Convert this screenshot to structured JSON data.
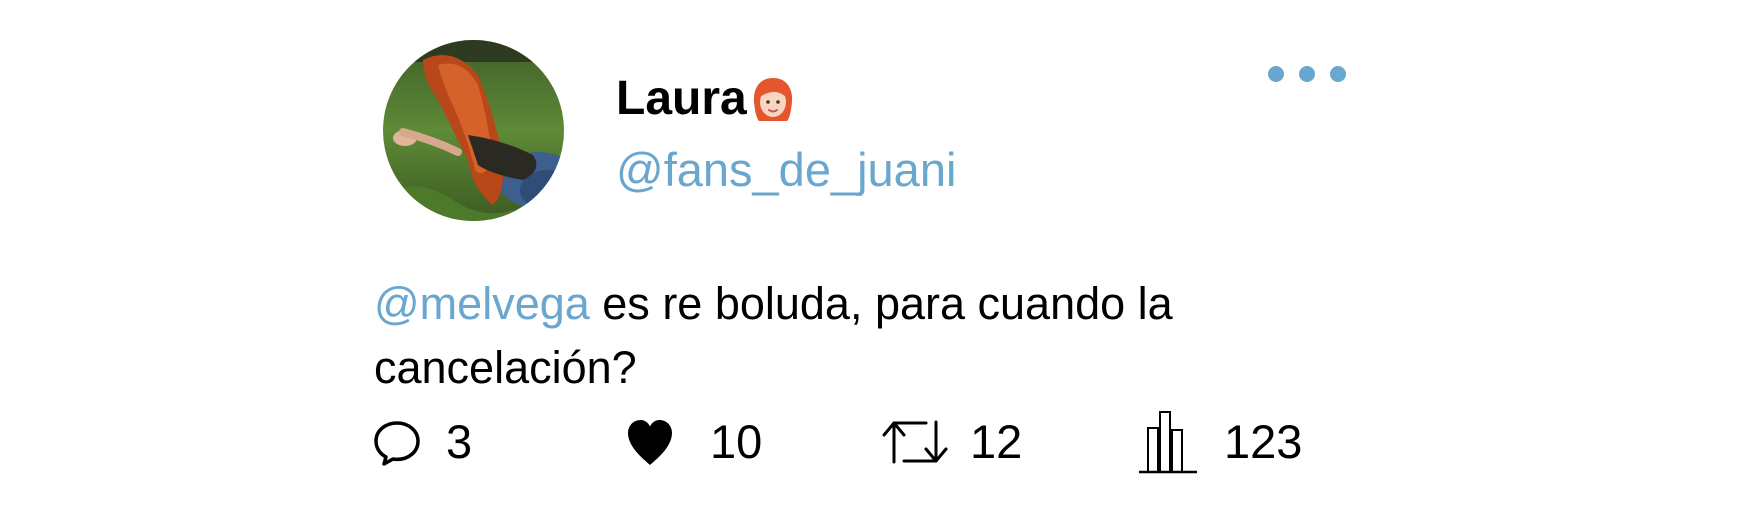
{
  "user": {
    "display_name": "Laura",
    "handle": "@fans_de_juani",
    "emoji": "woman-red-hair-emoji"
  },
  "tweet": {
    "mention": "@melvega",
    "text": " es re boluda, para cuando la cancelación?"
  },
  "actions": {
    "replies": "3",
    "likes": "10",
    "retweets": "12",
    "views": "123"
  },
  "icons": {
    "reply": "reply-icon",
    "like": "heart-icon",
    "retweet": "retweet-icon",
    "views": "views-icon",
    "more": "more-icon"
  },
  "colors": {
    "accent": "#6aa7cf",
    "text": "#000000",
    "background": "#ffffff"
  }
}
